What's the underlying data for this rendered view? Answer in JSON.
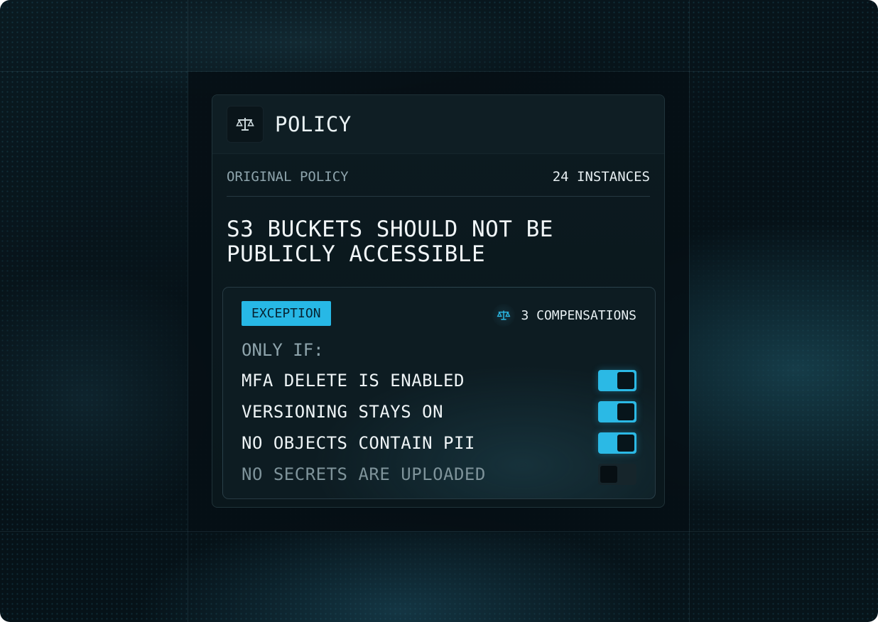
{
  "colors": {
    "accent": "#27b8e6",
    "background": "#061117",
    "card": "#0c1a20"
  },
  "header": {
    "icon": "scale-icon",
    "title": "POLICY"
  },
  "meta": {
    "label": "ORIGINAL POLICY",
    "instances": "24 INSTANCES"
  },
  "policy": {
    "title": "S3 BUCKETS SHOULD NOT BE PUBLICLY ACCESSIBLE"
  },
  "exception": {
    "badge": "EXCEPTION",
    "compensations_icon": "scale-icon",
    "compensations": "3 COMPENSATIONS",
    "only_if": "ONLY IF:",
    "conditions": [
      {
        "label": "MFA DELETE IS ENABLED",
        "enabled": true
      },
      {
        "label": "VERSIONING STAYS ON",
        "enabled": true
      },
      {
        "label": "NO OBJECTS CONTAIN PII",
        "enabled": true
      },
      {
        "label": "NO SECRETS ARE UPLOADED",
        "enabled": false
      }
    ]
  }
}
